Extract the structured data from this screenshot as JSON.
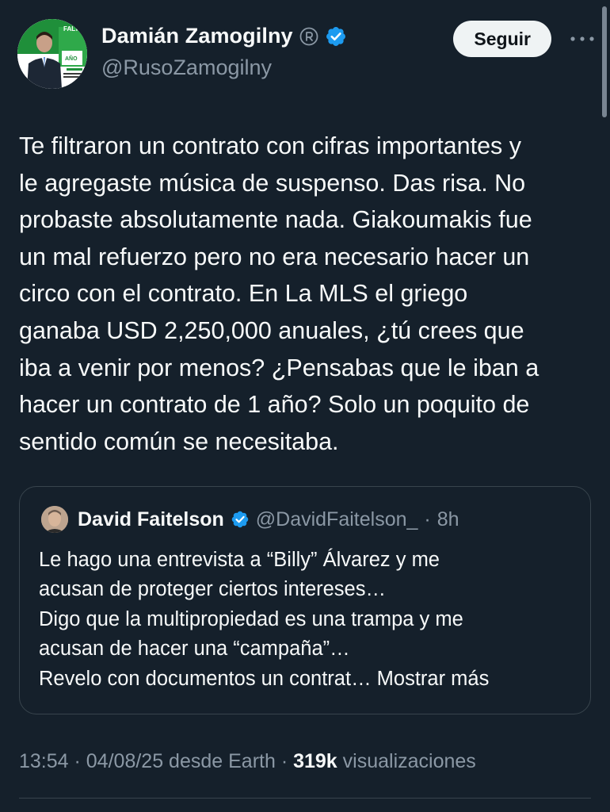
{
  "author": {
    "name": "Damián Zamogilny",
    "handle": "@RusoZamogilny",
    "avatar_text_top": "FALTA",
    "avatar_text_bottom": "AÑO"
  },
  "follow_button": {
    "label": "Seguir"
  },
  "tweet": {
    "text": "Te filtraron un contrato con cifras importantes y\nle agregaste música de suspenso. Das risa. No\nprobaste absolutamente nada. Giakoumakis fue\nun mal refuerzo pero no era necesario hacer un\ncirco con el contrato. En La MLS el griego\nganaba USD 2,250,000 anuales, ¿tú crees que\niba a venir por menos? ¿Pensabas que le iban a\nhacer un contrato de 1 año? Solo un poquito de\nsentido común se necesitaba."
  },
  "quote": {
    "name": "David Faitelson",
    "handle": "@DavidFaitelson_",
    "separator": "·",
    "time": "8h",
    "text": "Le hago una entrevista a “Billy” Álvarez y me\nacusan de proteger ciertos intereses…\nDigo que la multipropiedad es una trampa y me\nacusan de hacer una “campaña”…\nRevelo con documentos un contrat… ",
    "show_more": "Mostrar más"
  },
  "meta": {
    "time": "13:54",
    "sep1": " · ",
    "date": "04/08/25",
    "source": " desde Earth",
    "sep2": " · ",
    "views_count": "319k",
    "views_label": " visualizaciones"
  },
  "colors": {
    "background": "#15202b",
    "text": "#f7f9f9",
    "secondary": "#8b98a5",
    "verified": "#1d9bf0",
    "border": "#38444d"
  },
  "icons": [
    "registered-icon",
    "verified-badge-icon",
    "more-options-icon"
  ]
}
